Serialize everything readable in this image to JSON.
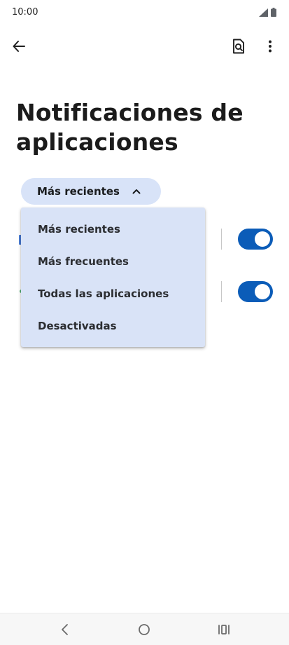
{
  "status_bar": {
    "time": "10:00"
  },
  "icons": {
    "back": "arrow-back-icon",
    "search": "search-settings-icon",
    "more": "more-vert-icon",
    "chevron": "chevron-up-icon"
  },
  "page": {
    "title": "Notificaciones de aplicaciones"
  },
  "filter": {
    "selected": "Más recientes"
  },
  "dropdown": {
    "options": [
      "Más recientes",
      "Más frecuentes",
      "Todas las aplicaciones",
      "Desactivadas"
    ]
  },
  "colors": {
    "accent": "#0b5cb8",
    "chip": "#d8e3f8",
    "menu": "#d9e3f7"
  }
}
